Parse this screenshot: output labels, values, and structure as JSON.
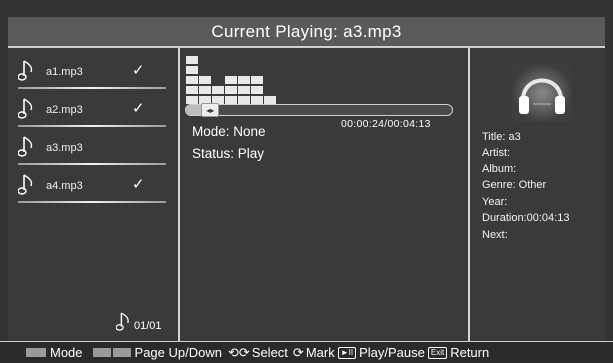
{
  "header": {
    "title": "Current Playing: a3.mp3"
  },
  "playlist": {
    "items": [
      {
        "name": "a1.mp3",
        "checked": "✓"
      },
      {
        "name": "a2.mp3",
        "checked": "✓"
      },
      {
        "name": "a3.mp3",
        "checked": ""
      },
      {
        "name": "a4.mp3",
        "checked": "✓"
      }
    ],
    "page": "01/01"
  },
  "player": {
    "time": "00:00:24/00:04:13",
    "mode": "Mode: None",
    "status": "Status: Play",
    "progress": 0.095,
    "equalizer_levels": [
      5,
      3,
      2,
      3,
      3,
      3,
      1
    ]
  },
  "info": {
    "title": "Title: a3",
    "artist": "Artist:",
    "album": "Album:",
    "genre": "Genre: Other",
    "year": "Year:",
    "duration": "Duration:00:04:13",
    "next": "Next:"
  },
  "footer": {
    "mode": "Mode",
    "page": "Page Up/Down",
    "select": "Select",
    "mark": "Mark",
    "play_icon": "►II",
    "play": "Play/Pause",
    "exit_icon": "Exit",
    "return": "Return"
  },
  "colors": {
    "background": "#333333",
    "header": "#5a5a5a",
    "swatch": "#9a9a9a"
  }
}
